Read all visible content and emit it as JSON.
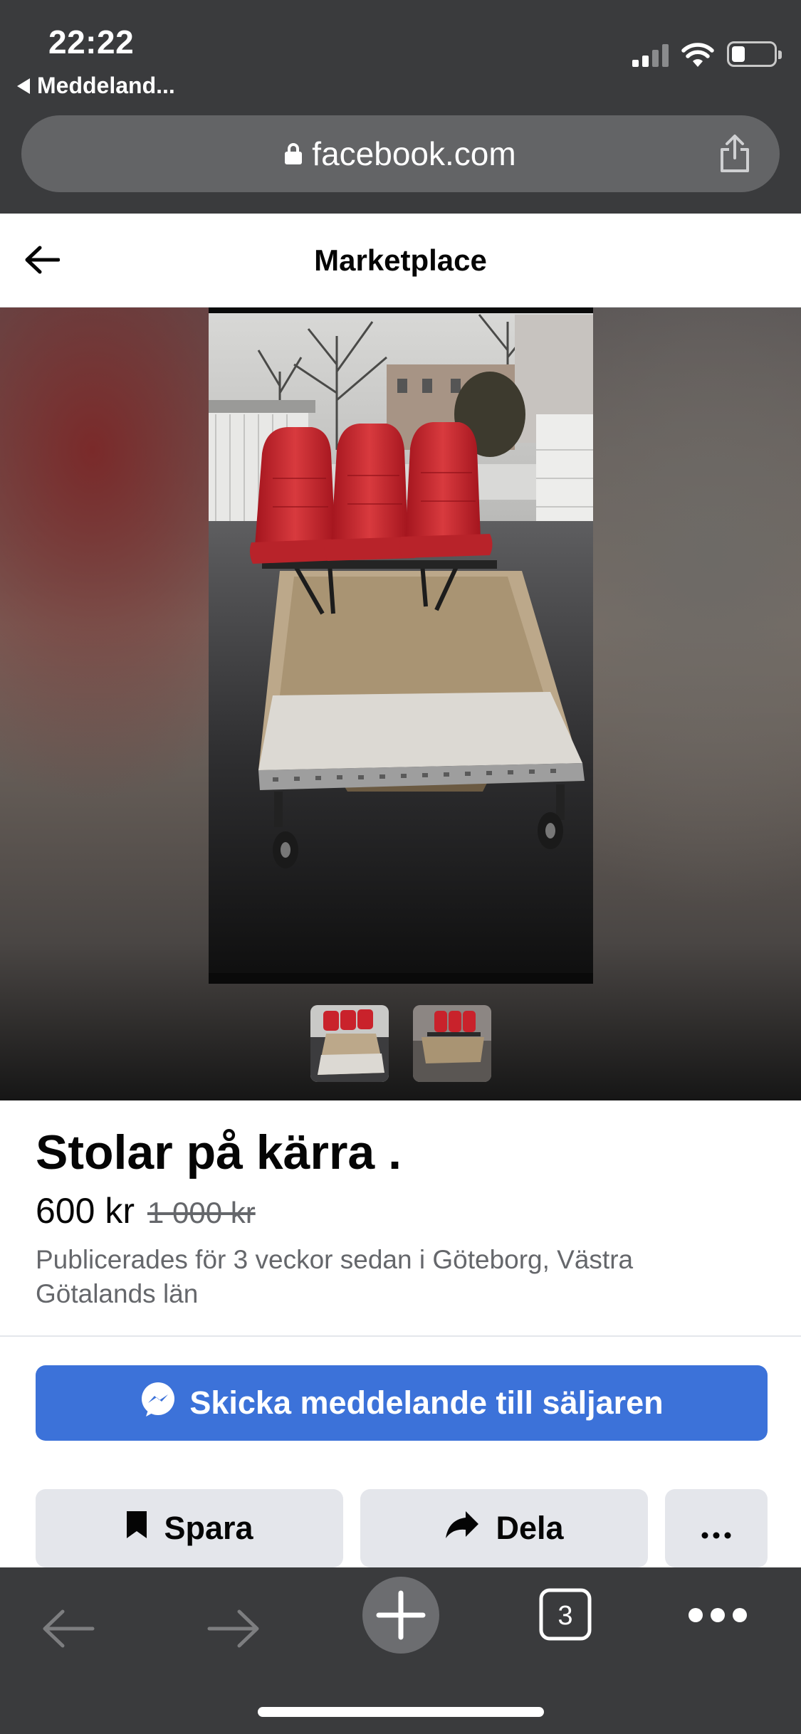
{
  "status_bar": {
    "time": "22:22",
    "back_app": "Meddeland..."
  },
  "browser": {
    "url": "facebook.com",
    "tab_count": "3"
  },
  "header": {
    "title": "Marketplace"
  },
  "listing": {
    "title": "Stolar på kärra .",
    "price": "600 kr",
    "old_price": "1 000 kr",
    "meta": "Publicerades för 3 veckor sedan i Göteborg, Västra Götalands län",
    "thumbnail_count": 2,
    "selected_thumbnail": 1
  },
  "actions": {
    "message_label": "Skicka meddelande till säljaren",
    "save_label": "Spara",
    "share_label": "Dela",
    "more_label": "···"
  },
  "icons": {
    "back": "arrow-left-icon",
    "lock": "lock-icon",
    "share": "share-icon",
    "messenger": "messenger-icon",
    "bookmark": "bookmark-icon",
    "share_arrow": "share-arrow-icon",
    "more": "more-icon",
    "nav_back": "back-arrow-icon",
    "nav_forward": "forward-arrow-icon",
    "new_tab": "plus-icon",
    "tabs": "tabs-icon",
    "menu": "more-menu-icon"
  },
  "colors": {
    "primary_button": "#3c72d9",
    "secondary_button": "#e4e6eb",
    "browser_chrome": "#3a3b3d",
    "seat_red": "#c9222b"
  }
}
